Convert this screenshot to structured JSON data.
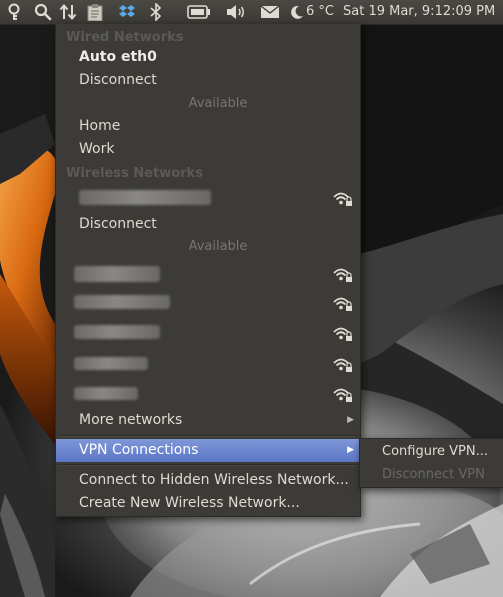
{
  "panel": {
    "temperature": "6 °C",
    "clock": "Sat 19 Mar,  9:12:09 PM"
  },
  "menu": {
    "wired_header": "Wired Networks",
    "wired_active": "Auto eth0",
    "wired_disconnect": "Disconnect",
    "wired_available": "Available",
    "wired_items": [
      "Home",
      "Work"
    ],
    "wireless_header": "Wireless Networks",
    "wireless_disconnect": "Disconnect",
    "wireless_available": "Available",
    "more_networks": "More networks",
    "vpn_connections": "VPN Connections",
    "connect_hidden": "Connect to Hidden Wireless Network...",
    "create_new": "Create New Wireless Network..."
  },
  "submenu": {
    "configure": "Configure VPN...",
    "disconnect": "Disconnect VPN"
  },
  "icons": {
    "panel": [
      "keyring-icon",
      "search-icon",
      "network-transfer-icon",
      "clipboard-icon",
      "dropbox-icon",
      "bluetooth-icon",
      "battery-icon",
      "volume-icon",
      "mail-icon",
      "moon-icon"
    ],
    "wifi": "wifi-signal-lock-icon"
  },
  "colors": {
    "panel_bg": "#3c3b37",
    "menu_bg": "#3c3b37",
    "highlight": "#6f87d0",
    "text": "#dfdbd2",
    "disabled_text": "#5c5a55"
  }
}
